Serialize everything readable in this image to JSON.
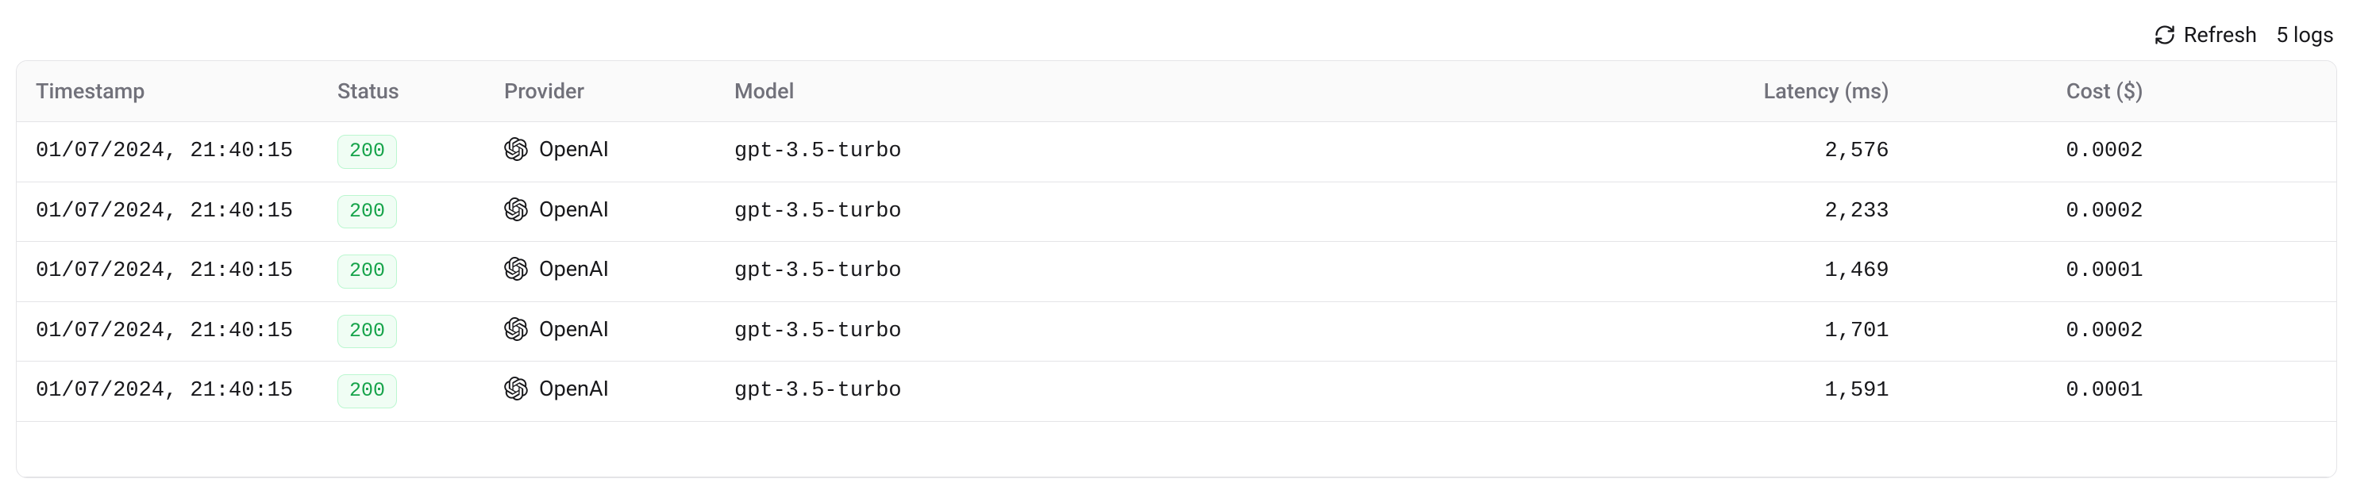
{
  "toolbar": {
    "refresh_label": "Refresh",
    "log_count_label": "5 logs"
  },
  "table": {
    "headers": {
      "timestamp": "Timestamp",
      "status": "Status",
      "provider": "Provider",
      "model": "Model",
      "latency": "Latency (ms)",
      "cost": "Cost ($)"
    },
    "rows": [
      {
        "timestamp": "01/07/2024, 21:40:15",
        "status": "200",
        "provider": "OpenAI",
        "model": "gpt-3.5-turbo",
        "latency": "2,576",
        "cost": "0.0002"
      },
      {
        "timestamp": "01/07/2024, 21:40:15",
        "status": "200",
        "provider": "OpenAI",
        "model": "gpt-3.5-turbo",
        "latency": "2,233",
        "cost": "0.0002"
      },
      {
        "timestamp": "01/07/2024, 21:40:15",
        "status": "200",
        "provider": "OpenAI",
        "model": "gpt-3.5-turbo",
        "latency": "1,469",
        "cost": "0.0001"
      },
      {
        "timestamp": "01/07/2024, 21:40:15",
        "status": "200",
        "provider": "OpenAI",
        "model": "gpt-3.5-turbo",
        "latency": "1,701",
        "cost": "0.0002"
      },
      {
        "timestamp": "01/07/2024, 21:40:15",
        "status": "200",
        "provider": "OpenAI",
        "model": "gpt-3.5-turbo",
        "latency": "1,591",
        "cost": "0.0001"
      }
    ]
  }
}
